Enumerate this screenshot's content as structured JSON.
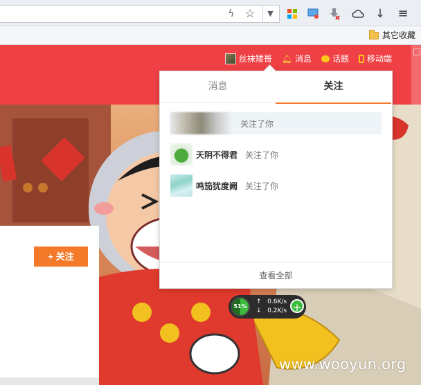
{
  "browser": {
    "bookmark_folder": "其它收藏"
  },
  "header": {
    "nav": {
      "username": "丝袜矮哥",
      "messages": "消息",
      "topics": "话题",
      "mobile": "移动端"
    }
  },
  "profile": {
    "follow_button": "+ 关注"
  },
  "dropdown": {
    "tabs": [
      {
        "label": "消息",
        "active": false
      },
      {
        "label": "关注",
        "active": true
      }
    ],
    "notifications": [
      {
        "name": "",
        "action": "关注了你",
        "highlighted": true
      },
      {
        "name": "天阴不得君",
        "action": "关注了你",
        "highlighted": false
      },
      {
        "name": "鸣笳犹度阙",
        "action": "关注了你",
        "highlighted": false
      }
    ],
    "view_all": "查看全部"
  },
  "net_widget": {
    "percent": "51%",
    "upload": "0.6K/s",
    "download": "0.2K/s"
  },
  "watermark": "www.wooyun.org",
  "colors": {
    "header_red": "#ef4046",
    "accent_orange": "#f47a29"
  }
}
